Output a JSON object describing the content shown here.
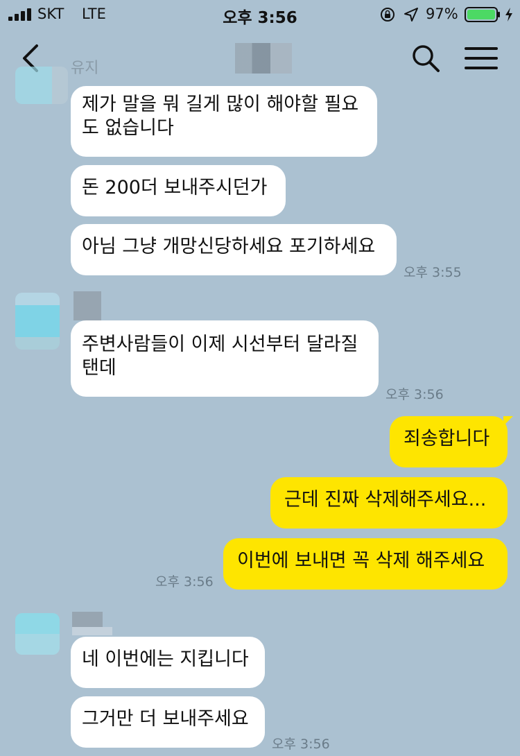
{
  "status_bar": {
    "carrier": "SKT",
    "network": "LTE",
    "time": "오후 3:56",
    "battery": "97%"
  },
  "header": {
    "back_icon": "chevron-left-icon",
    "search_icon": "search-icon",
    "menu_icon": "hamburger-menu-icon"
  },
  "faded_sender_name": "유지",
  "messages": [
    {
      "side": "received",
      "text": "제가 말을 뭐 길게 많이 해야할 필요도 없습니다"
    },
    {
      "side": "received",
      "text": "돈 200더 보내주시던가"
    },
    {
      "side": "received",
      "text": "아님 그냥 개망신당하세요 포기하세요",
      "time": "오후 3:55"
    },
    {
      "side": "received",
      "text": "주변사람들이 이제 시선부터 달라질탠데",
      "time": "오후 3:56"
    },
    {
      "side": "sent",
      "text": "죄송합니다"
    },
    {
      "side": "sent",
      "text": "근데 진짜 삭제해주세요..."
    },
    {
      "side": "sent",
      "text": "이번에 보내면 꼭 삭제 해주세요",
      "time": "오후 3:56"
    },
    {
      "side": "received",
      "text": "네 이번에는 지킵니다"
    },
    {
      "side": "received",
      "text": "그거만 더 보내주세요",
      "time": "오후 3:56"
    }
  ],
  "colors": {
    "background": "#abc1d1",
    "sent_bubble": "#fee500",
    "received_bubble": "#ffffff",
    "battery": "#4cd964"
  }
}
